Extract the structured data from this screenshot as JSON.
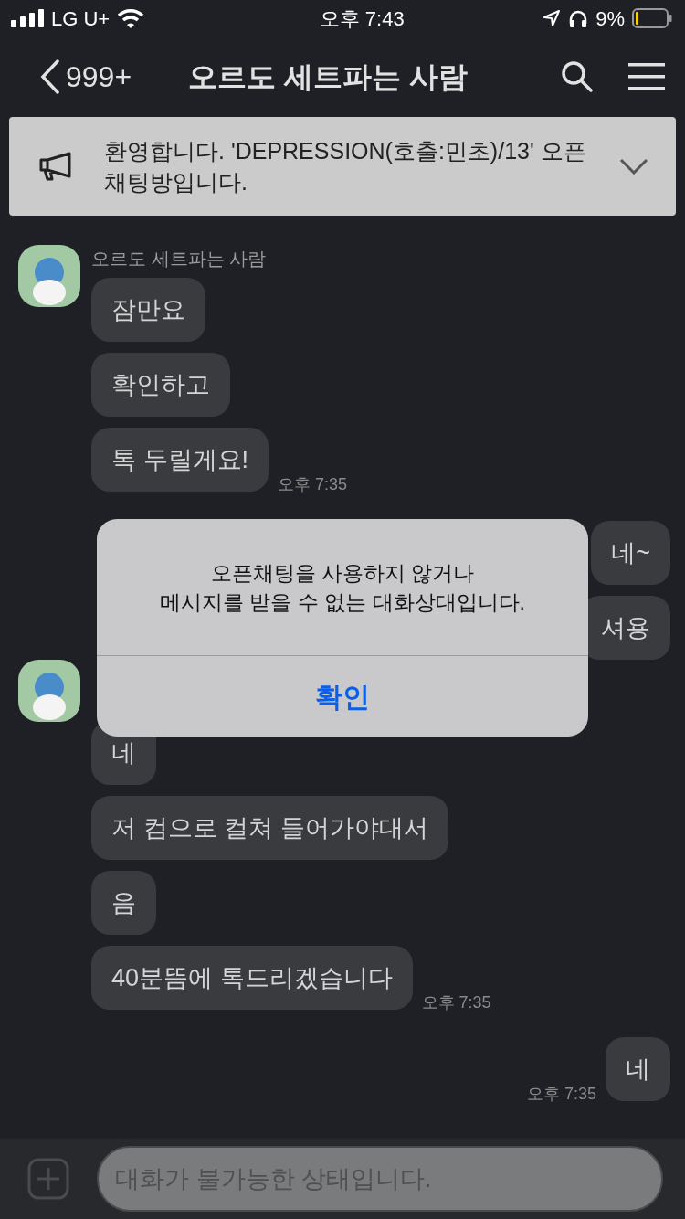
{
  "status_bar": {
    "carrier": "LG U+",
    "time": "오후 7:43",
    "battery": "9%"
  },
  "header": {
    "back_count": "999+",
    "title": "오르도 세트파는 사람"
  },
  "notice": {
    "text": "환영합니다. 'DEPRESSION(호출:민초)/13' 오픈채팅방입니다."
  },
  "messages": [
    {
      "kind": "incoming",
      "sender": "오르도 세트파는 사람",
      "bubbles": [
        "잠만요",
        "확인하고",
        "톡 두릴게요!"
      ],
      "time": "오후 7:35"
    },
    {
      "kind": "outgoing",
      "bubbles": [
        "네~",
        "셔용"
      ]
    },
    {
      "kind": "incoming",
      "bubbles": [
        "네",
        "저 컴으로 컬쳐 들어가야대서",
        "음",
        "40분뜸에 톡드리겠습니다"
      ],
      "time": "오후 7:35"
    },
    {
      "kind": "outgoing",
      "bubbles": [
        "네"
      ],
      "time": "오후 7:35"
    }
  ],
  "alert": {
    "message": "오픈채팅을 사용하지 않거나\n메시지를 받을 수 없는 대화상대입니다.",
    "button": "확인"
  },
  "composer": {
    "placeholder": "대화가 불가능한 상태입니다."
  }
}
